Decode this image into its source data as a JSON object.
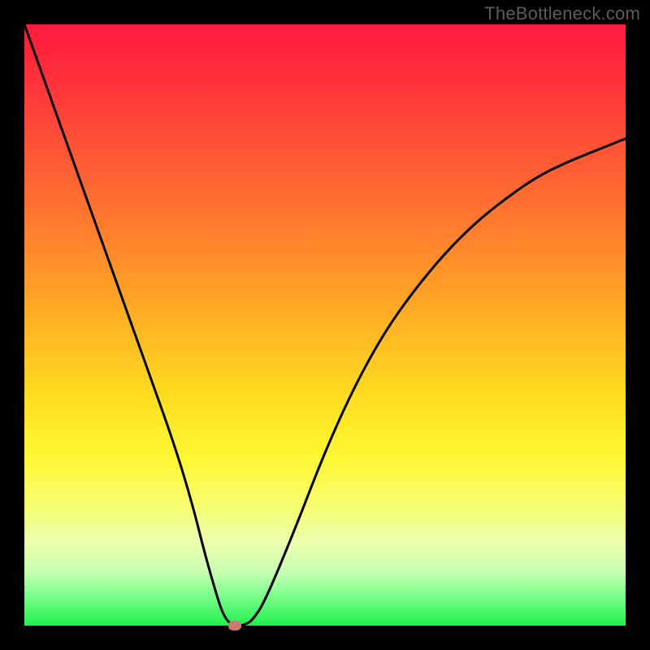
{
  "watermark": "TheBottleneck.com",
  "chart_data": {
    "type": "line",
    "title": "",
    "xlabel": "",
    "ylabel": "",
    "xlim": [
      0,
      100
    ],
    "ylim": [
      0,
      100
    ],
    "series": [
      {
        "name": "bottleneck-curve",
        "x": [
          0,
          5,
          10,
          15,
          20,
          25,
          28,
          30,
          32,
          33,
          34,
          35,
          36,
          37,
          38,
          40,
          45,
          50,
          55,
          60,
          65,
          70,
          75,
          80,
          85,
          90,
          95,
          100
        ],
        "y": [
          100,
          86,
          72,
          58,
          44,
          30,
          20,
          12,
          5,
          2,
          0.5,
          0,
          0,
          0.3,
          1,
          4,
          16,
          29,
          40,
          49,
          56,
          62,
          67,
          71,
          74.5,
          77,
          79,
          81
        ]
      }
    ],
    "marker": {
      "x": 35,
      "y": 0,
      "name": "optimal-point"
    },
    "gradient_stops": [
      {
        "pct": 0,
        "color": "#ff1a3c"
      },
      {
        "pct": 50,
        "color": "#ffb423"
      },
      {
        "pct": 72,
        "color": "#fff733"
      },
      {
        "pct": 100,
        "color": "#1fef4e"
      }
    ]
  }
}
